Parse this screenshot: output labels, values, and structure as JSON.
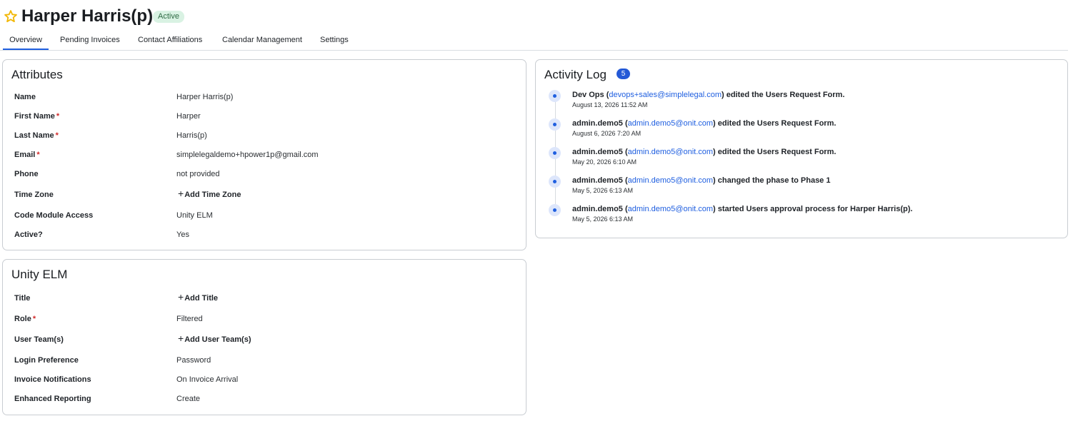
{
  "header": {
    "title": "Harper Harris(p)",
    "status": "Active"
  },
  "tabs": [
    {
      "label": "Overview",
      "active": true
    },
    {
      "label": "Pending Invoices",
      "active": false
    },
    {
      "label": "Contact Affiliations",
      "active": false
    },
    {
      "label": "Calendar Management",
      "active": false
    },
    {
      "label": "Settings",
      "active": false
    }
  ],
  "attributes": {
    "title": "Attributes",
    "rows": [
      {
        "label": "Name",
        "required": false,
        "value": "Harper Harris(p)"
      },
      {
        "label": "First Name",
        "required": true,
        "value": "Harper"
      },
      {
        "label": "Last Name",
        "required": true,
        "value": "Harris(p)"
      },
      {
        "label": "Email",
        "required": true,
        "value": "simplelegaldemo+hpower1p@gmail.com"
      },
      {
        "label": "Phone",
        "required": false,
        "value": "not provided"
      },
      {
        "label": "Time Zone",
        "required": false,
        "action": "Add Time Zone"
      },
      {
        "label": "Code Module Access",
        "required": false,
        "value": "Unity ELM"
      },
      {
        "label": "Active?",
        "required": false,
        "value": "Yes"
      }
    ]
  },
  "unity": {
    "title": "Unity ELM",
    "rows": [
      {
        "label": "Title",
        "required": false,
        "action": "Add Title"
      },
      {
        "label": "Role",
        "required": true,
        "value": "Filtered"
      },
      {
        "label": "User Team(s)",
        "required": false,
        "action": "Add User Team(s)"
      },
      {
        "label": "Login Preference",
        "required": false,
        "value": "Password"
      },
      {
        "label": "Invoice Notifications",
        "required": false,
        "value": "On Invoice Arrival"
      },
      {
        "label": "Enhanced Reporting",
        "required": false,
        "value": "Create"
      }
    ]
  },
  "activity": {
    "title": "Activity Log",
    "count": "5",
    "items": [
      {
        "actor": "Dev Ops",
        "email": "devops+sales@simplelegal.com",
        "action": "edited the Users Request Form.",
        "time": "August 13, 2026 11:52 AM"
      },
      {
        "actor": "admin.demo5",
        "email": "admin.demo5@onit.com",
        "action": "edited the Users Request Form.",
        "time": "August 6, 2026 7:20 AM"
      },
      {
        "actor": "admin.demo5",
        "email": "admin.demo5@onit.com",
        "action": "edited the Users Request Form.",
        "time": "May 20, 2026 6:10 AM"
      },
      {
        "actor": "admin.demo5",
        "email": "admin.demo5@onit.com",
        "action": "changed the phase to Phase 1",
        "time": "May 5, 2026 6:13 AM"
      },
      {
        "actor": "admin.demo5",
        "email": "admin.demo5@onit.com",
        "action": "started Users approval process for Harper Harris(p).",
        "time": "May 5, 2026 6:13 AM"
      }
    ]
  },
  "icons": {
    "favorite": "star-icon",
    "add": "plus-icon",
    "timeline": "timeline-dot-icon"
  },
  "colors": {
    "accent": "#1f5fe0",
    "star": "#f2b705",
    "badge_bg": "#d9f2e3",
    "badge_text": "#2f6b45",
    "required": "#d22b2b"
  }
}
